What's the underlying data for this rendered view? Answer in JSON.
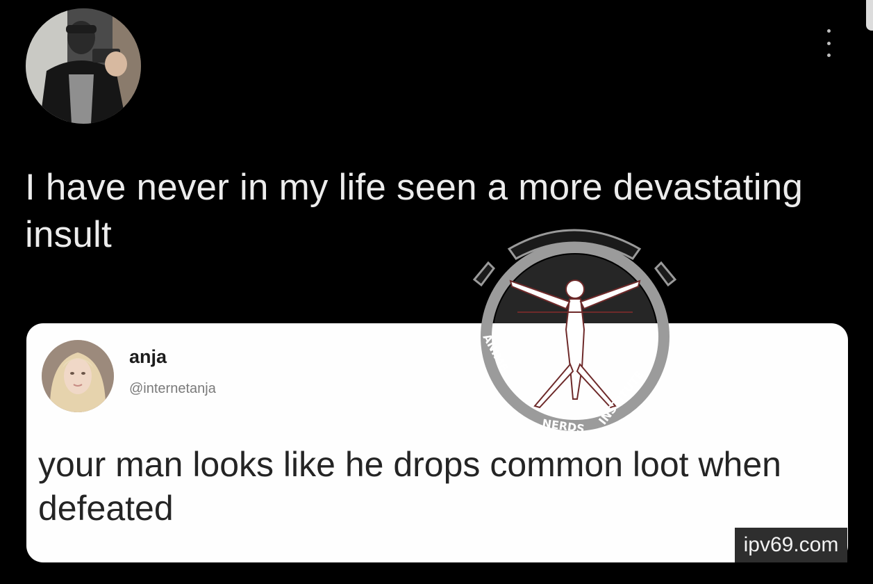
{
  "tweet": {
    "text": "I have never in my life seen a more devastating insult",
    "more_icon": "more-vertical-icon"
  },
  "quote": {
    "name": "anja",
    "handle": "@internetanja",
    "text": "your man looks like he drops common loot when defeated"
  },
  "watermark": {
    "words_left": "ANIME",
    "words_bottom": "NERDS",
    "words_right": "INSTITUTE"
  },
  "site_badge": "ipv69.com"
}
